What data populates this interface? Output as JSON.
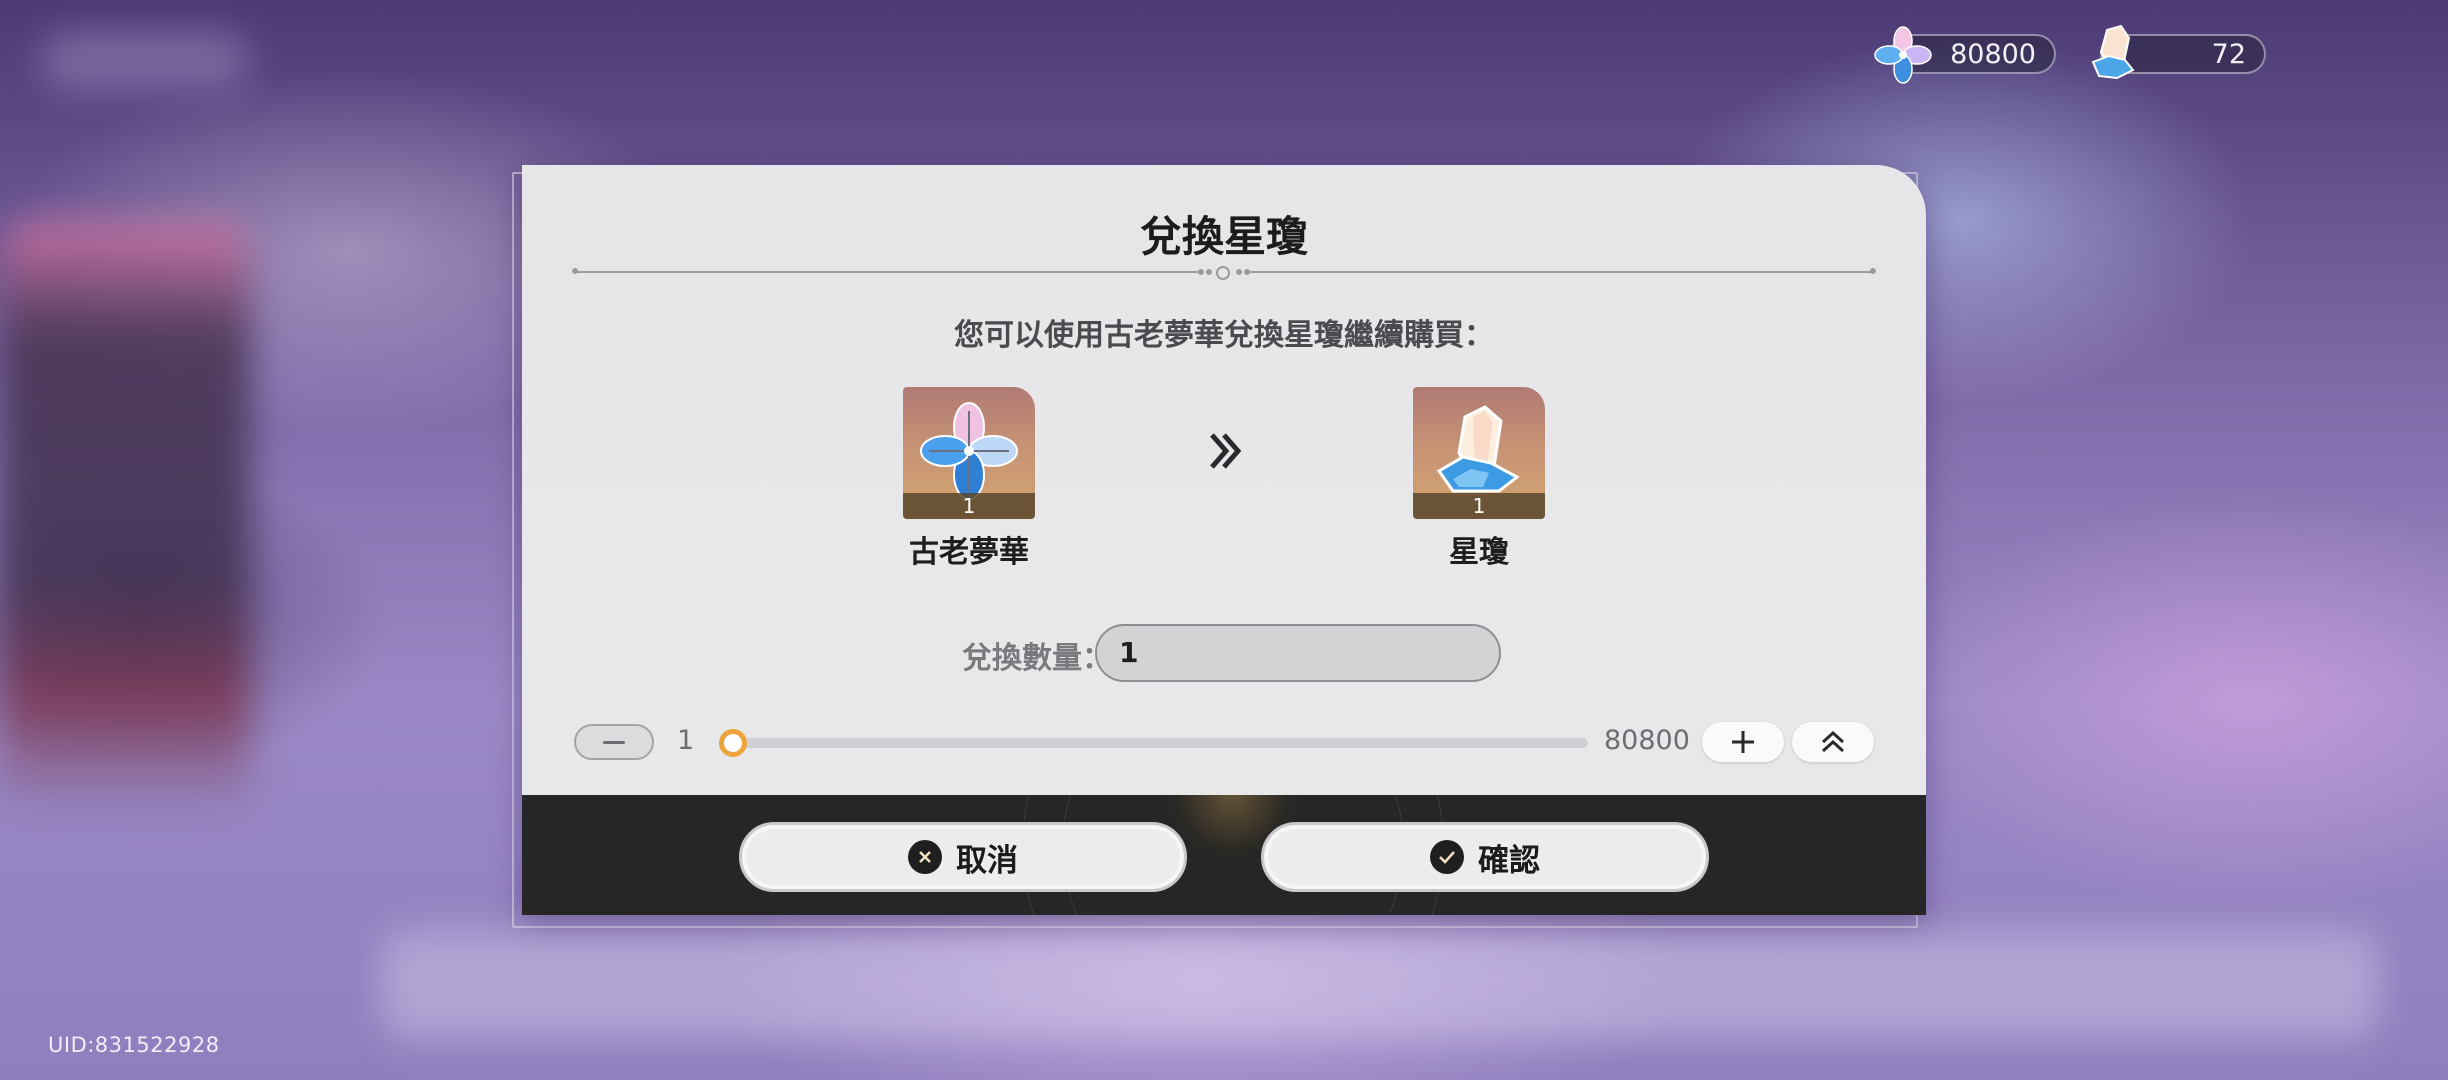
{
  "header": {
    "stellar_jade": "80800",
    "star_rail_pass": "72"
  },
  "uid": "UID:831522928",
  "dialog": {
    "title": "兌換星瓊",
    "subtitle": "您可以使用古老夢華兌換星瓊繼續購買：",
    "from_item": {
      "name": "古老夢華",
      "count": "1",
      "icon": "oneiric-shard-icon"
    },
    "to_item": {
      "name": "星瓊",
      "count": "1",
      "icon": "stellar-jade-icon"
    },
    "quantity_label": "兌換數量：",
    "quantity_value": "1",
    "slider": {
      "min": "1",
      "max": "80800",
      "value": 1
    },
    "cancel_label": "取消",
    "confirm_label": "確認"
  },
  "colors": {
    "accent": "#eda43c",
    "footer": "#262626",
    "dialog_bg": "#e8e8ea"
  }
}
